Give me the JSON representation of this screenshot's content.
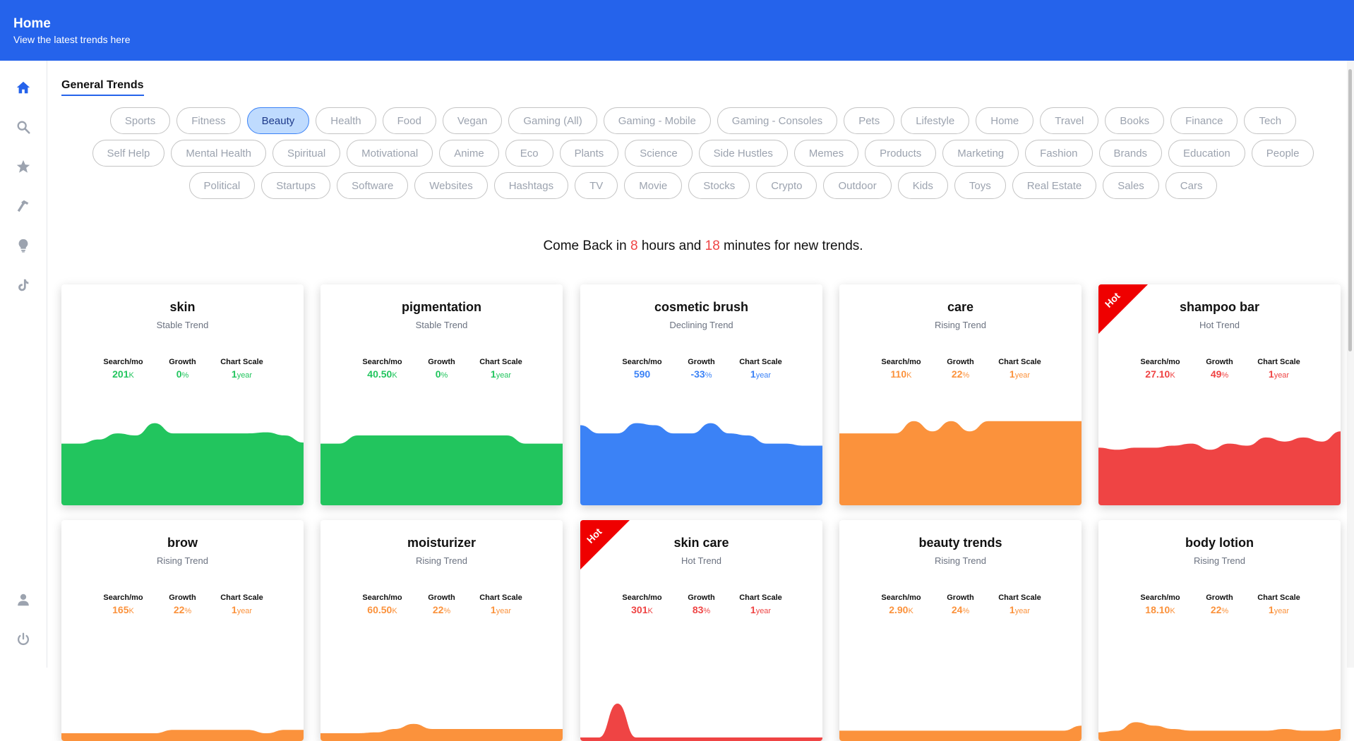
{
  "header": {
    "title": "Home",
    "subtitle": "View the latest trends here"
  },
  "sidebar": {
    "items": [
      {
        "name": "home-icon",
        "active": true
      },
      {
        "name": "search-icon"
      },
      {
        "name": "star-icon"
      },
      {
        "name": "hammer-icon"
      },
      {
        "name": "lightbulb-icon"
      },
      {
        "name": "tiktok-icon"
      },
      {
        "name": "user-icon"
      },
      {
        "name": "power-icon"
      }
    ]
  },
  "section_title": "General Trends",
  "categories": [
    [
      "Sports",
      "Fitness",
      "Beauty",
      "Health",
      "Food",
      "Vegan",
      "Gaming (All)",
      "Gaming - Mobile",
      "Gaming - Consoles",
      "Pets",
      "Lifestyle",
      "Home",
      "Travel",
      "Books",
      "Finance",
      "Tech"
    ],
    [
      "Self Help",
      "Mental Health",
      "Spiritual",
      "Motivational",
      "Anime",
      "Eco",
      "Plants",
      "Science",
      "Side Hustles",
      "Memes",
      "Products",
      "Marketing",
      "Fashion",
      "Brands",
      "Education",
      "People"
    ],
    [
      "Political",
      "Startups",
      "Software",
      "Websites",
      "Hashtags",
      "TV",
      "Movie",
      "Stocks",
      "Crypto",
      "Outdoor",
      "Kids",
      "Toys",
      "Real Estate",
      "Sales",
      "Cars"
    ]
  ],
  "active_category": "Beauty",
  "countdown": {
    "prefix": "Come Back in ",
    "hours": "8",
    "mid": " hours and ",
    "minutes": "18",
    "suffix": " minutes for new trends."
  },
  "stat_labels": {
    "search": "Search/mo",
    "growth": "Growth",
    "scale": "Chart Scale"
  },
  "hot_label": "Hot",
  "colors": {
    "stable": "#22c55e",
    "declining": "#3b82f6",
    "rising": "#fb923c",
    "hot": "#ef4444"
  },
  "cards": [
    {
      "title": "skin",
      "trend": "Stable Trend",
      "kind": "stable",
      "search": "201",
      "search_unit": "K",
      "growth": "0",
      "growth_unit": "%",
      "scale": "1",
      "scale_unit": "year",
      "hot": false,
      "series": [
        52,
        52,
        56,
        62,
        60,
        72,
        62,
        62,
        62,
        62,
        62,
        63,
        60,
        53
      ]
    },
    {
      "title": "pigmentation",
      "trend": "Stable Trend",
      "kind": "stable",
      "search": "40.50",
      "search_unit": "K",
      "growth": "0",
      "growth_unit": "%",
      "scale": "1",
      "scale_unit": "year",
      "hot": false,
      "series": [
        52,
        52,
        60,
        60,
        60,
        60,
        60,
        60,
        60,
        60,
        60,
        52,
        52,
        52
      ]
    },
    {
      "title": "cosmetic brush",
      "trend": "Declining Trend",
      "kind": "declining",
      "search": "590",
      "search_unit": "",
      "growth": "-33",
      "growth_unit": "%",
      "scale": "1",
      "scale_unit": "year",
      "hot": false,
      "series": [
        70,
        62,
        62,
        72,
        70,
        62,
        62,
        72,
        62,
        60,
        52,
        52,
        50,
        50
      ]
    },
    {
      "title": "care",
      "trend": "Rising Trend",
      "kind": "rising",
      "search": "110",
      "search_unit": "K",
      "growth": "22",
      "growth_unit": "%",
      "scale": "1",
      "scale_unit": "year",
      "hot": false,
      "series": [
        62,
        62,
        62,
        62,
        74,
        64,
        74,
        64,
        74,
        74,
        74,
        74,
        74,
        74
      ]
    },
    {
      "title": "shampoo bar",
      "trend": "Hot Trend",
      "kind": "hot",
      "search": "27.10",
      "search_unit": "K",
      "growth": "49",
      "growth_unit": "%",
      "scale": "1",
      "scale_unit": "year",
      "hot": true,
      "series": [
        48,
        46,
        48,
        48,
        50,
        52,
        46,
        52,
        50,
        58,
        54,
        58,
        54,
        64
      ]
    },
    {
      "title": "brow",
      "trend": "Rising Trend",
      "kind": "rising",
      "search": "165",
      "search_unit": "K",
      "growth": "22",
      "growth_unit": "%",
      "scale": "1",
      "scale_unit": "year",
      "hot": false,
      "series": [
        5,
        5,
        5,
        5,
        5,
        5,
        9,
        9,
        9,
        9,
        9,
        5,
        9,
        9
      ]
    },
    {
      "title": "moisturizer",
      "trend": "Rising Trend",
      "kind": "rising",
      "search": "60.50",
      "search_unit": "K",
      "growth": "22",
      "growth_unit": "%",
      "scale": "1",
      "scale_unit": "year",
      "hot": false,
      "series": [
        5,
        5,
        5,
        6,
        10,
        16,
        10,
        10,
        10,
        10,
        10,
        10,
        10,
        10
      ]
    },
    {
      "title": "skin care",
      "trend": "Hot Trend",
      "kind": "hot",
      "search": "301",
      "search_unit": "K",
      "growth": "83",
      "growth_unit": "%",
      "scale": "1",
      "scale_unit": "year",
      "hot": true,
      "series": [
        0,
        0,
        40,
        0,
        0,
        0,
        0,
        0,
        0,
        0,
        0,
        0,
        0,
        0
      ]
    },
    {
      "title": "beauty trends",
      "trend": "Rising Trend",
      "kind": "rising",
      "search": "2.90",
      "search_unit": "K",
      "growth": "24",
      "growth_unit": "%",
      "scale": "1",
      "scale_unit": "year",
      "hot": false,
      "series": [
        8,
        8,
        8,
        8,
        8,
        8,
        8,
        8,
        8,
        8,
        8,
        8,
        8,
        14
      ]
    },
    {
      "title": "body lotion",
      "trend": "Rising Trend",
      "kind": "rising",
      "search": "18.10",
      "search_unit": "K",
      "growth": "22",
      "growth_unit": "%",
      "scale": "1",
      "scale_unit": "year",
      "hot": false,
      "series": [
        6,
        8,
        18,
        14,
        10,
        8,
        8,
        8,
        8,
        8,
        10,
        8,
        8,
        10
      ]
    }
  ]
}
